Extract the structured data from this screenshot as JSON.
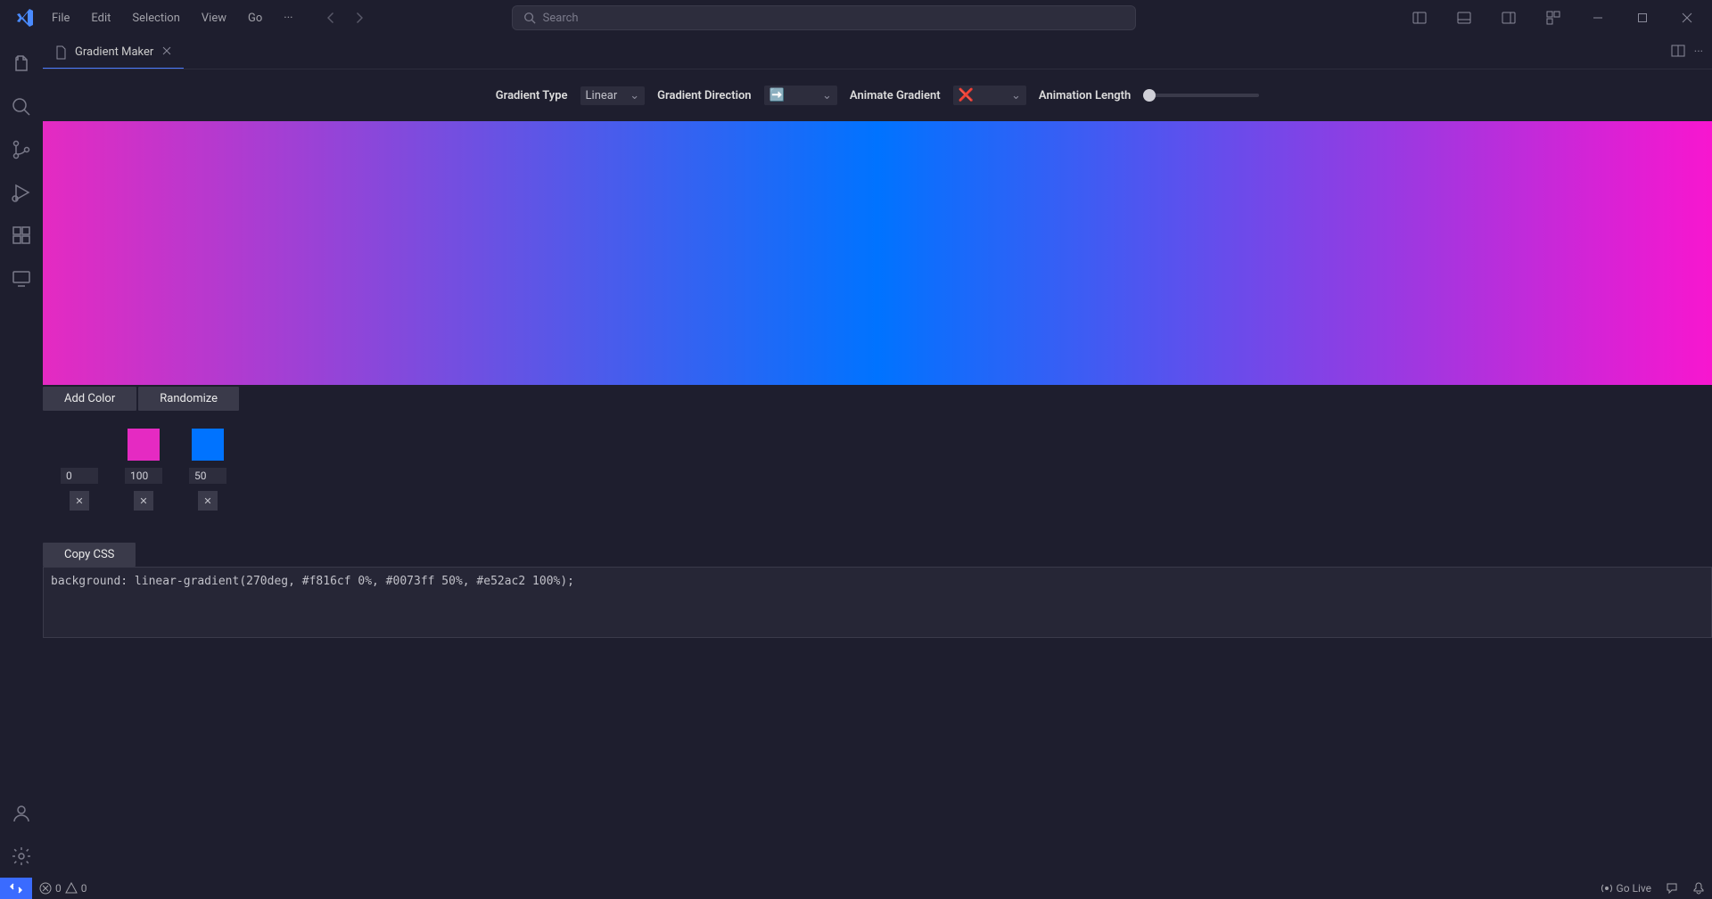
{
  "menu": {
    "file": "File",
    "edit": "Edit",
    "selection": "Selection",
    "view": "View",
    "go": "Go"
  },
  "search": {
    "placeholder": "Search"
  },
  "tab": {
    "title": "Gradient Maker"
  },
  "controls": {
    "type_label": "Gradient Type",
    "type_value": "Linear",
    "direction_label": "Gradient Direction",
    "direction_value": "➡️",
    "animate_label": "Animate Gradient",
    "animate_value": "❌",
    "length_label": "Animation Length"
  },
  "buttons": {
    "add_color": "Add Color",
    "randomize": "Randomize",
    "copy_css": "Copy CSS"
  },
  "swatches": [
    {
      "color": "#f816cf",
      "pos": "0"
    },
    {
      "color": "#e52ac2",
      "pos": "100"
    },
    {
      "color": "#0073ff",
      "pos": "50"
    }
  ],
  "css_output": "background: linear-gradient(270deg, #f816cf 0%, #0073ff 50%, #e52ac2 100%);",
  "status": {
    "errors": "0",
    "warnings": "0",
    "go_live": "Go Live"
  },
  "chart_data": {
    "type": "gradient",
    "gradient_type": "linear",
    "angle_deg": 270,
    "stops": [
      {
        "color": "#f816cf",
        "position": 0
      },
      {
        "color": "#0073ff",
        "position": 50
      },
      {
        "color": "#e52ac2",
        "position": 100
      }
    ]
  }
}
